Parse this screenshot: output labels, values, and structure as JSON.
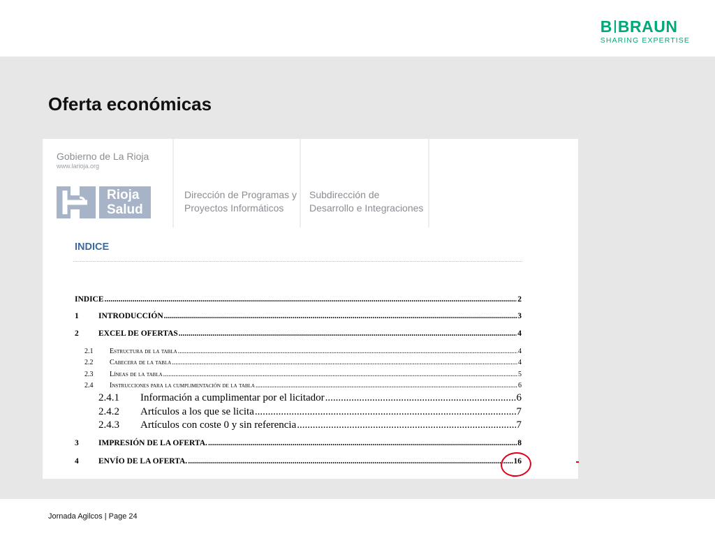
{
  "header": {
    "brand_name_left": "B",
    "brand_name_right": "BRAUN",
    "brand_tagline": "SHARING EXPERTISE"
  },
  "slide": {
    "title": "Oferta económicas"
  },
  "document": {
    "organization": "Gobierno de La Rioja",
    "website": "www.larioja.org",
    "logo_text_line1": "Rioja",
    "logo_text_line2": "Salud",
    "dept1_line1": "Dirección de Programas y",
    "dept1_line2": "Proyectos Informáticos",
    "dept2_line1": "Subdirección de",
    "dept2_line2": "Desarrollo e Integraciones",
    "index_heading": "INDICE",
    "toc": [
      {
        "num": "",
        "label": "INDICE",
        "page": "2"
      },
      {
        "num": "1",
        "label": "INTRODUCCIÓN",
        "page": "3"
      },
      {
        "num": "2",
        "label": "EXCEL DE OFERTAS",
        "page": "4"
      },
      {
        "num": "2.1",
        "label": "Estructura de la tabla",
        "page": "4"
      },
      {
        "num": "2.2",
        "label": "Cabecera de la tabla",
        "page": "4"
      },
      {
        "num": "2.3",
        "label": "Líneas de la tabla",
        "page": "5"
      },
      {
        "num": "2.4",
        "label": "Instrucciones para la cumplimentación de la tabla",
        "page": "6"
      },
      {
        "num": "2.4.1",
        "label": "Información a cumplimentar por el licitador",
        "page": "6"
      },
      {
        "num": "2.4.2",
        "label": "Artículos a los que se licita",
        "page": "7"
      },
      {
        "num": "2.4.3",
        "label": "Artículos con coste 0 y sin referencia",
        "page": "7"
      },
      {
        "num": "3",
        "label": "IMPRESIÓN DE LA OFERTA.",
        "page": "8"
      },
      {
        "num": "4",
        "label": "ENVÍO DE LA OFERTA.",
        "page": "16"
      }
    ]
  },
  "footer": {
    "text": "Jornada Agilcos | Page 24"
  },
  "colors": {
    "brand_green": "#00a97a",
    "index_blue": "#3c6aa0",
    "logo_blue": "#a7b3c6",
    "annotation_red": "#e0001a",
    "slide_background": "#e7e7e7"
  }
}
